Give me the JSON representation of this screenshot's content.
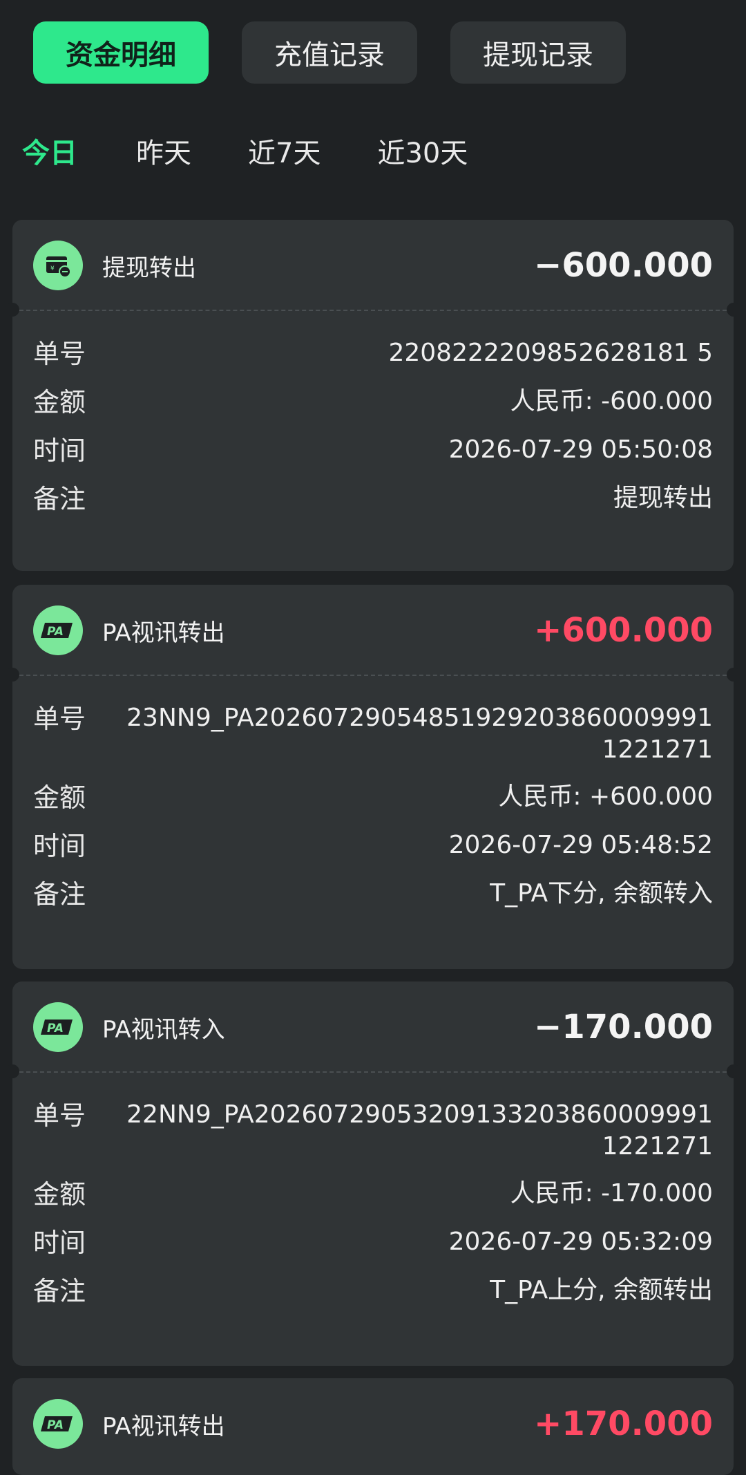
{
  "tabs": [
    "资金明细",
    "充值记录",
    "提现记录"
  ],
  "filters": [
    "今日",
    "昨天",
    "近7天",
    "近30天"
  ],
  "labels": {
    "order": "单号",
    "amount": "金额",
    "time": "时间",
    "note": "备注"
  },
  "records": [
    {
      "title": "提现转出",
      "icon": "withdraw-card-icon",
      "amount": "−600.000",
      "order": "2208222209852628181 5",
      "amount_detail": "人民币: -600.000",
      "time": "2026-07-29 05:50:08",
      "note": "提现转出"
    },
    {
      "title": "PA视讯转出",
      "icon": "pa-logo-icon",
      "amount": "+600.000",
      "order": "23NN9_PA20260729054851929203860009991 1221271",
      "amount_detail": "人民币: +600.000",
      "time": "2026-07-29 05:48:52",
      "note": "T_PA下分, 余额转入"
    },
    {
      "title": "PA视讯转入",
      "icon": "pa-logo-icon",
      "amount": "−170.000",
      "order": "22NN9_PA20260729053209133203860009991 1221271",
      "amount_detail": "人民币: -170.000",
      "time": "2026-07-29 05:32:09",
      "note": "T_PA上分, 余额转出"
    },
    {
      "title": "PA视讯转出",
      "icon": "pa-logo-icon",
      "amount": "+170.000"
    }
  ],
  "colors": {
    "accent": "#2ee88c",
    "positive": "#ff4a64",
    "card": "#303436",
    "background": "#1f2224"
  }
}
